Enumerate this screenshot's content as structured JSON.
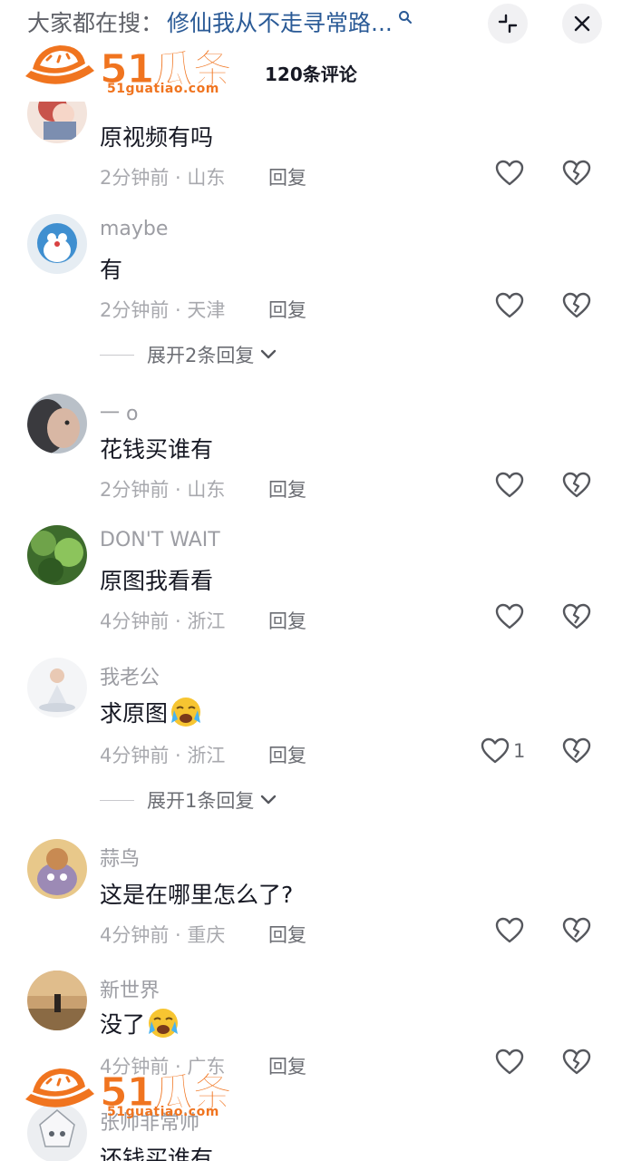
{
  "header": {
    "search_prefix": "大家都在搜：",
    "search_term": "修仙我从不走寻常路...",
    "comment_count": "120条评论"
  },
  "watermark": {
    "brand": "51瓜条",
    "url": "51guatiao.com"
  },
  "comments": [
    {
      "username": "",
      "text": "原视频有吗",
      "time": "2分钟前",
      "location": "山东",
      "reply": "回复",
      "likes": ""
    },
    {
      "username": "maybe",
      "text": "有",
      "time": "2分钟前",
      "location": "天津",
      "reply": "回复",
      "likes": "",
      "expand": "展开2条回复"
    },
    {
      "username": "一 o",
      "text": "花钱买谁有",
      "time": "2分钟前",
      "location": "山东",
      "reply": "回复",
      "likes": ""
    },
    {
      "username": "DON'T WAIT",
      "text": "原图我看看",
      "time": "4分钟前",
      "location": "浙江",
      "reply": "回复",
      "likes": ""
    },
    {
      "username": "我老公",
      "text": "求原图",
      "time": "4分钟前",
      "location": "浙江",
      "reply": "回复",
      "likes": "1",
      "expand": "展开1条回复"
    },
    {
      "username": "蒜鸟",
      "text": "这是在哪里怎么了?",
      "time": "4分钟前",
      "location": "重庆",
      "reply": "回复",
      "likes": ""
    },
    {
      "username": "新世界",
      "text": "没了",
      "time": "4分钟前",
      "location": "广东",
      "reply": "回复",
      "likes": ""
    },
    {
      "username": "张帅非常帅",
      "text": "还钱买谁有",
      "time": "",
      "location": "",
      "reply": "",
      "likes": ""
    }
  ],
  "icons": {
    "search": "search-icon",
    "collapse": "collapse-icon",
    "close": "close-icon",
    "like": "heart-outline-icon",
    "dislike": "broken-heart-icon",
    "expand": "chevron-down-icon",
    "cry_emoji": "crying-face-emoji"
  },
  "colors": {
    "search_term": "#2a5a96",
    "watermark": "#f0741f",
    "meta_text": "#a8a9ae"
  }
}
